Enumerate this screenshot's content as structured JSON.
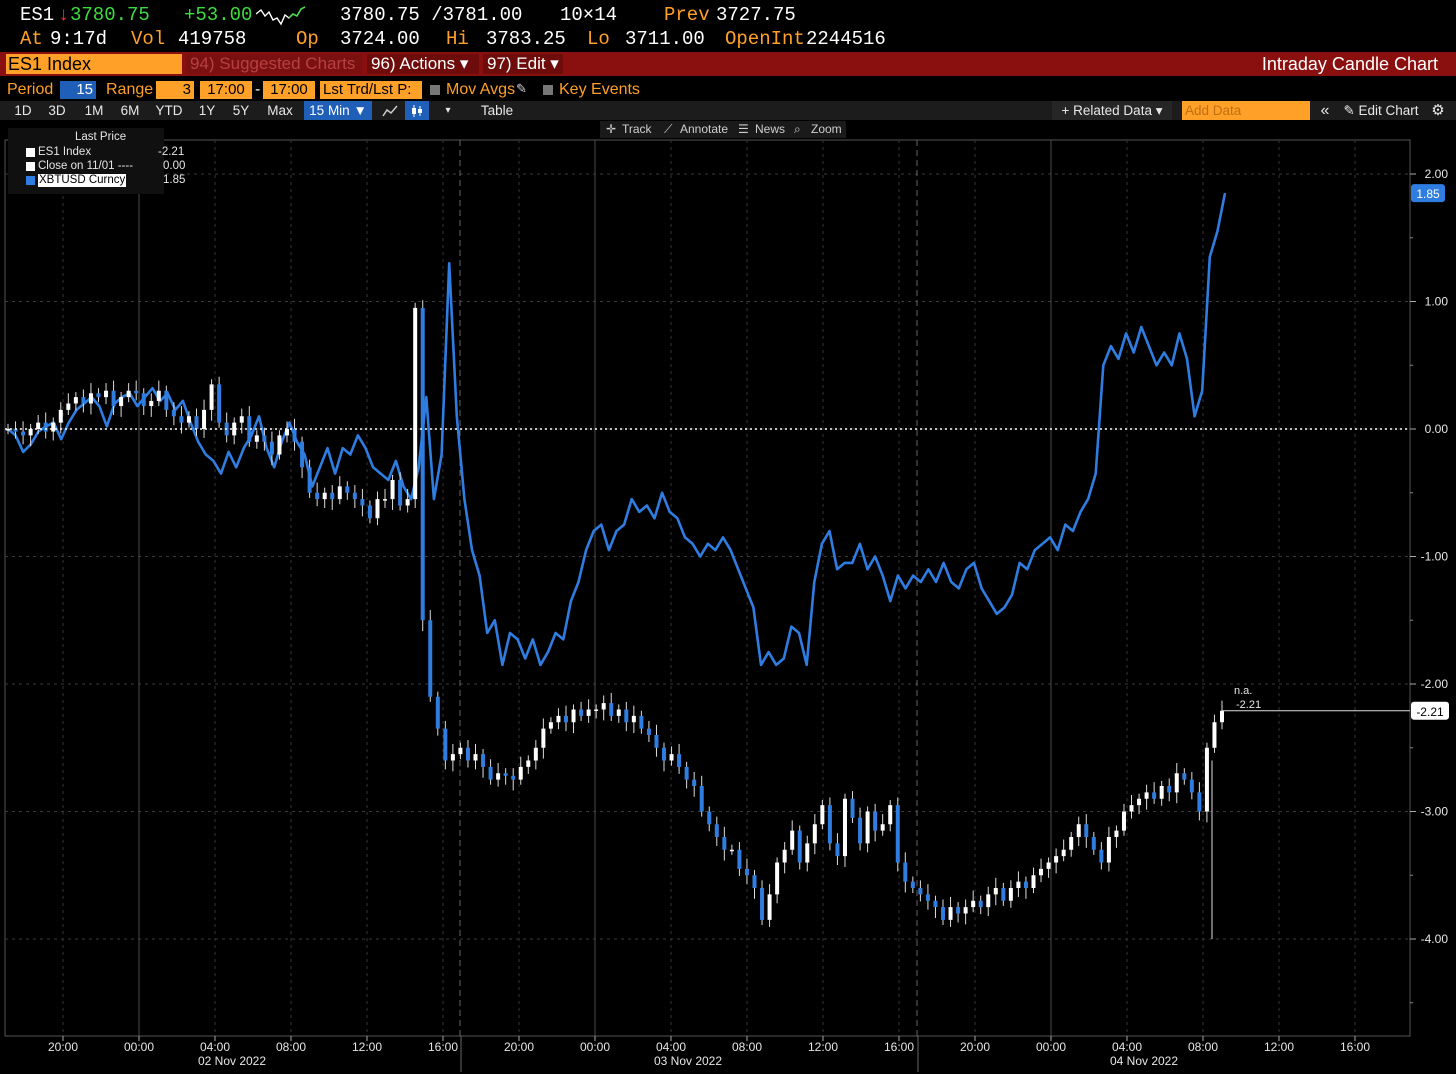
{
  "quote": {
    "ticker": "ES1",
    "arrow": "↓",
    "last": "3780.75",
    "change": "+53.00",
    "bid_ask": "3780.75 /3781.00",
    "size": "10×14",
    "prev_label": "Prev",
    "prev": "3727.75",
    "at_label": "At",
    "at": "9:17d",
    "vol_label": "Vol",
    "vol": "419758",
    "op_label": "Op",
    "op": "3724.00",
    "hi_label": "Hi",
    "hi": "3783.25",
    "lo_label": "Lo",
    "lo": "3711.00",
    "oi_label": "OpenInt",
    "oi": "2244516"
  },
  "menu": {
    "security": "ES1 Index",
    "suggested": "94) Suggested Charts",
    "actions": "96) Actions ▾",
    "edit": "97) Edit ▾",
    "title": "Intraday Candle Chart"
  },
  "params": {
    "period_label": "Period",
    "period": "15",
    "range_label": "Range",
    "range": "3",
    "from": "17:00",
    "dash": "-",
    "to": "17:00",
    "price_type": "Lst Trd/Lst P:",
    "mov_avgs": "Mov Avgs",
    "key_events": "Key Events"
  },
  "toolbar": {
    "ranges": [
      "1D",
      "3D",
      "1M",
      "6M",
      "YTD",
      "1Y",
      "5Y",
      "Max"
    ],
    "interval": "15 Min ▼",
    "table": "Table",
    "related": "+ Related Data ▾",
    "add_data_placeholder": "Add Data",
    "collapse": "«",
    "edit_chart": "✎ Edit Chart",
    "settings": "⚙"
  },
  "tools": {
    "track": "Track",
    "annotate": "Annotate",
    "news": "News",
    "zoom": "Zoom"
  },
  "legend": {
    "header": "Last Price",
    "items": [
      {
        "name": "ES1 Index",
        "value": "-2.21",
        "color": "#ffffff"
      },
      {
        "name": "Close on 11/01 ----",
        "value": "0.00",
        "color": "#ffffff"
      },
      {
        "name": "XBTUSD Curncy",
        "value": "1.85",
        "color": "#2f7de1"
      }
    ]
  },
  "chart_data": {
    "type": "line",
    "y_axis": {
      "ticks": [
        2.0,
        1.0,
        0.0,
        -1.0,
        -2.0,
        -3.0,
        -4.0
      ],
      "labels": [
        "2.00",
        "1.00",
        "0.00",
        "-1.00",
        "-2.00",
        "-3.00",
        "-4.00"
      ],
      "ylim": [
        -4.6,
        2.4
      ]
    },
    "x_axis": {
      "tick_labels": [
        "20:00",
        "00:00",
        "04:00",
        "08:00",
        "12:00",
        "16:00",
        "20:00",
        "00:00",
        "04:00",
        "08:00",
        "12:00",
        "16:00",
        "20:00",
        "00:00",
        "04:00",
        "08:00",
        "12:00",
        "16:00"
      ],
      "date_labels": [
        "02 Nov 2022",
        "03 Nov 2022",
        "04 Nov 2022"
      ]
    },
    "reference_line": {
      "name": "Close on 11/01",
      "value": 0.0
    },
    "grid": true,
    "annotations": {
      "last_label_top": "n.a.",
      "last_label_bottom": "-2.21",
      "xbt_last": "1.85",
      "es1_last": "-2.21"
    },
    "series": [
      {
        "name": "XBTUSD Curncy",
        "style": "line",
        "color": "#2f7de1",
        "values": [
          0.0,
          -0.05,
          -0.18,
          -0.12,
          -0.02,
          0.02,
          0.05,
          -0.08,
          0.05,
          0.15,
          0.2,
          0.25,
          0.18,
          0.02,
          0.2,
          0.25,
          0.28,
          0.18,
          0.25,
          0.32,
          0.22,
          0.28,
          0.15,
          0.22,
          0.05,
          -0.1,
          -0.2,
          -0.25,
          -0.35,
          -0.18,
          -0.3,
          -0.15,
          -0.05,
          0.1,
          -0.15,
          -0.3,
          -0.1,
          0.05,
          -0.1,
          -0.2,
          -0.45,
          -0.3,
          -0.15,
          -0.35,
          -0.15,
          -0.2,
          -0.05,
          -0.15,
          -0.3,
          -0.35,
          -0.4,
          -0.25,
          -0.45,
          -0.55,
          -0.3,
          0.25,
          -0.55,
          -0.2,
          1.3,
          0.1,
          -0.55,
          -0.95,
          -1.15,
          -1.6,
          -1.5,
          -1.85,
          -1.6,
          -1.65,
          -1.8,
          -1.65,
          -1.85,
          -1.75,
          -1.6,
          -1.65,
          -1.35,
          -1.2,
          -0.95,
          -0.8,
          -0.75,
          -0.95,
          -0.8,
          -0.75,
          -0.55,
          -0.65,
          -0.6,
          -0.7,
          -0.5,
          -0.65,
          -0.7,
          -0.85,
          -0.9,
          -1.0,
          -0.9,
          -0.95,
          -0.85,
          -0.95,
          -1.1,
          -1.25,
          -1.4,
          -1.85,
          -1.75,
          -1.85,
          -1.8,
          -1.55,
          -1.6,
          -1.85,
          -1.2,
          -0.9,
          -0.8,
          -1.1,
          -1.05,
          -1.05,
          -0.9,
          -1.1,
          -1.0,
          -1.15,
          -1.35,
          -1.15,
          -1.25,
          -1.15,
          -1.2,
          -1.1,
          -1.2,
          -1.05,
          -1.2,
          -1.25,
          -1.1,
          -1.05,
          -1.25,
          -1.35,
          -1.45,
          -1.4,
          -1.3,
          -1.05,
          -1.1,
          -0.95,
          -0.9,
          -0.85,
          -0.95,
          -0.75,
          -0.8,
          -0.65,
          -0.55,
          -0.35,
          0.5,
          0.65,
          0.55,
          0.75,
          0.6,
          0.8,
          0.65,
          0.5,
          0.6,
          0.5,
          0.75,
          0.55,
          0.1,
          0.3,
          1.35,
          1.55,
          1.85
        ]
      },
      {
        "name": "ES1 Index",
        "style": "candle",
        "color": "#ffffff",
        "down_color": "#2f7de1",
        "values": [
          0.0,
          -0.02,
          -0.05,
          0.0,
          0.05,
          -0.02,
          0.05,
          0.15,
          0.2,
          0.25,
          0.2,
          0.28,
          0.25,
          0.3,
          0.18,
          0.25,
          0.3,
          0.28,
          0.18,
          0.22,
          0.3,
          0.15,
          0.1,
          0.05,
          0.1,
          0.0,
          0.15,
          0.35,
          0.05,
          -0.05,
          0.05,
          0.1,
          -0.1,
          -0.05,
          -0.1,
          -0.2,
          -0.05,
          0.0,
          -0.1,
          -0.3,
          -0.5,
          -0.55,
          -0.5,
          -0.55,
          -0.45,
          -0.5,
          -0.55,
          -0.6,
          -0.7,
          -0.55,
          -0.55,
          -0.4,
          -0.6,
          -0.55,
          0.95,
          -1.5,
          -2.1,
          -2.35,
          -2.6,
          -2.55,
          -2.5,
          -2.6,
          -2.55,
          -2.65,
          -2.75,
          -2.7,
          -2.72,
          -2.75,
          -2.65,
          -2.6,
          -2.5,
          -2.35,
          -2.3,
          -2.25,
          -2.3,
          -2.2,
          -2.25,
          -2.2,
          -2.2,
          -2.15,
          -2.25,
          -2.2,
          -2.3,
          -2.25,
          -2.35,
          -2.4,
          -2.5,
          -2.6,
          -2.55,
          -2.65,
          -2.75,
          -2.8,
          -3.0,
          -3.1,
          -3.2,
          -3.3,
          -3.3,
          -3.45,
          -3.5,
          -3.6,
          -3.85,
          -3.65,
          -3.4,
          -3.3,
          -3.15,
          -3.4,
          -3.25,
          -3.1,
          -2.95,
          -3.25,
          -3.35,
          -2.9,
          -3.05,
          -3.25,
          -3.0,
          -3.15,
          -3.1,
          -2.95,
          -3.4,
          -3.55,
          -3.6,
          -3.65,
          -3.7,
          -3.75,
          -3.85,
          -3.75,
          -3.8,
          -3.75,
          -3.7,
          -3.75,
          -3.65,
          -3.6,
          -3.7,
          -3.6,
          -3.55,
          -3.6,
          -3.5,
          -3.45,
          -3.4,
          -3.35,
          -3.3,
          -3.2,
          -3.1,
          -3.2,
          -3.3,
          -3.4,
          -3.2,
          -3.15,
          -3.0,
          -2.95,
          -2.9,
          -2.85,
          -2.9,
          -2.8,
          -2.85,
          -2.7,
          -2.75,
          -2.85,
          -3.0,
          -2.5,
          -2.3,
          -2.21
        ]
      }
    ]
  }
}
